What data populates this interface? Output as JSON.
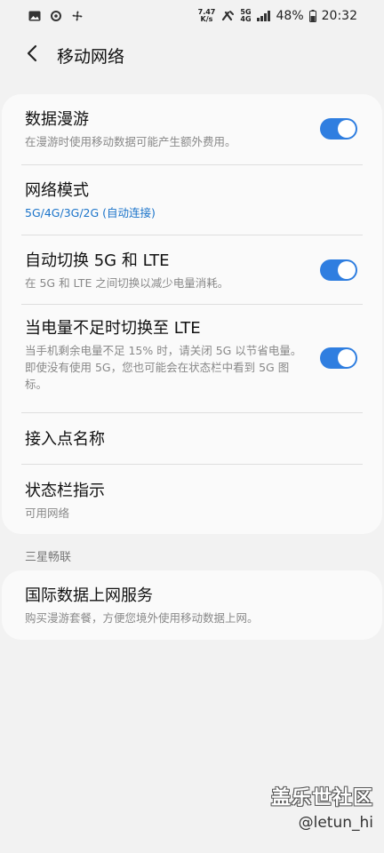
{
  "status_bar": {
    "net_speed_top": "7.47",
    "net_speed_bottom": "K/s",
    "net_type_top": "5G",
    "net_type_bottom": "4G",
    "battery": "48%",
    "time": "20:32"
  },
  "header": {
    "title": "移动网络"
  },
  "settings": [
    {
      "title": "数据漫游",
      "subtitle": "在漫游时使用移动数据可能产生额外费用。",
      "toggle": true
    },
    {
      "title": "网络模式",
      "subtitle": "5G/4G/3G/2G (自动连接)"
    },
    {
      "title": "自动切换 5G 和 LTE",
      "subtitle": "在 5G 和 LTE 之间切换以减少电量消耗。",
      "toggle": true
    },
    {
      "title": "当电量不足时切换至 LTE",
      "subtitle": "当手机剩余电量不足 15% 时，请关闭 5G 以节省电量。即使没有使用 5G，您也可能会在状态栏中看到 5G 图标。",
      "toggle": true
    },
    {
      "title": "接入点名称"
    },
    {
      "title": "状态栏指示",
      "subtitle": "可用网络"
    }
  ],
  "section2": {
    "label": "三星畅联",
    "item": {
      "title": "国际数据上网服务",
      "subtitle": "购买漫游套餐，方便您境外使用移动数据上网。"
    }
  },
  "watermark": {
    "title": "盖乐世社区",
    "handle": "@letun_hi"
  },
  "colors": {
    "accent": "#2f7ee0",
    "link": "#1a73c9",
    "background": "#f2f2f2",
    "card": "#fafafa"
  }
}
